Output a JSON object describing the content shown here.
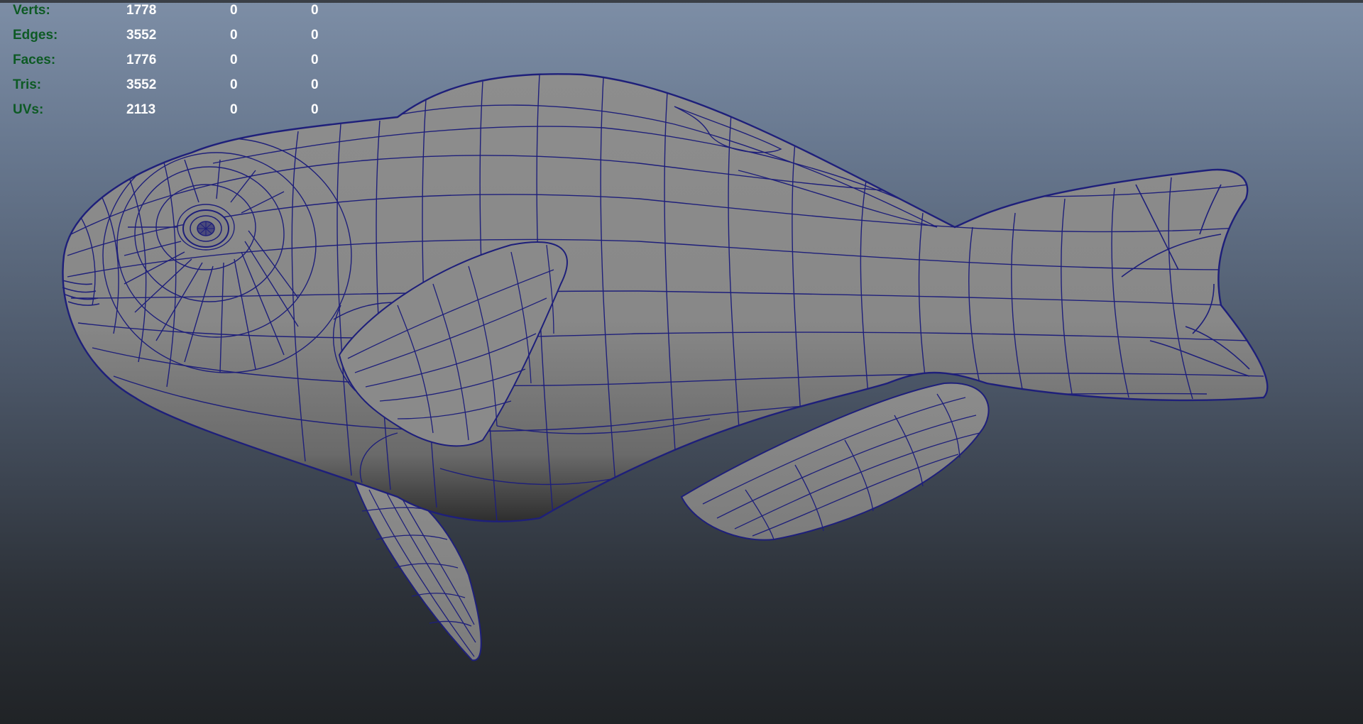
{
  "hud": {
    "rows": [
      {
        "label": "Verts:",
        "col1": "1778",
        "col2": "0",
        "col3": "0"
      },
      {
        "label": "Edges:",
        "col1": "3552",
        "col2": "0",
        "col3": "0"
      },
      {
        "label": "Faces:",
        "col1": "1776",
        "col2": "0",
        "col3": "0"
      },
      {
        "label": "Tris:",
        "col1": "3552",
        "col2": "0",
        "col3": "0"
      },
      {
        "label": "UVs:",
        "col1": "2113",
        "col2": "0",
        "col3": "0"
      }
    ]
  },
  "model": {
    "subject": "fish-wireframe-mesh",
    "wire_color": "#1e1f7a",
    "surface_color": "#8c8c8c"
  }
}
